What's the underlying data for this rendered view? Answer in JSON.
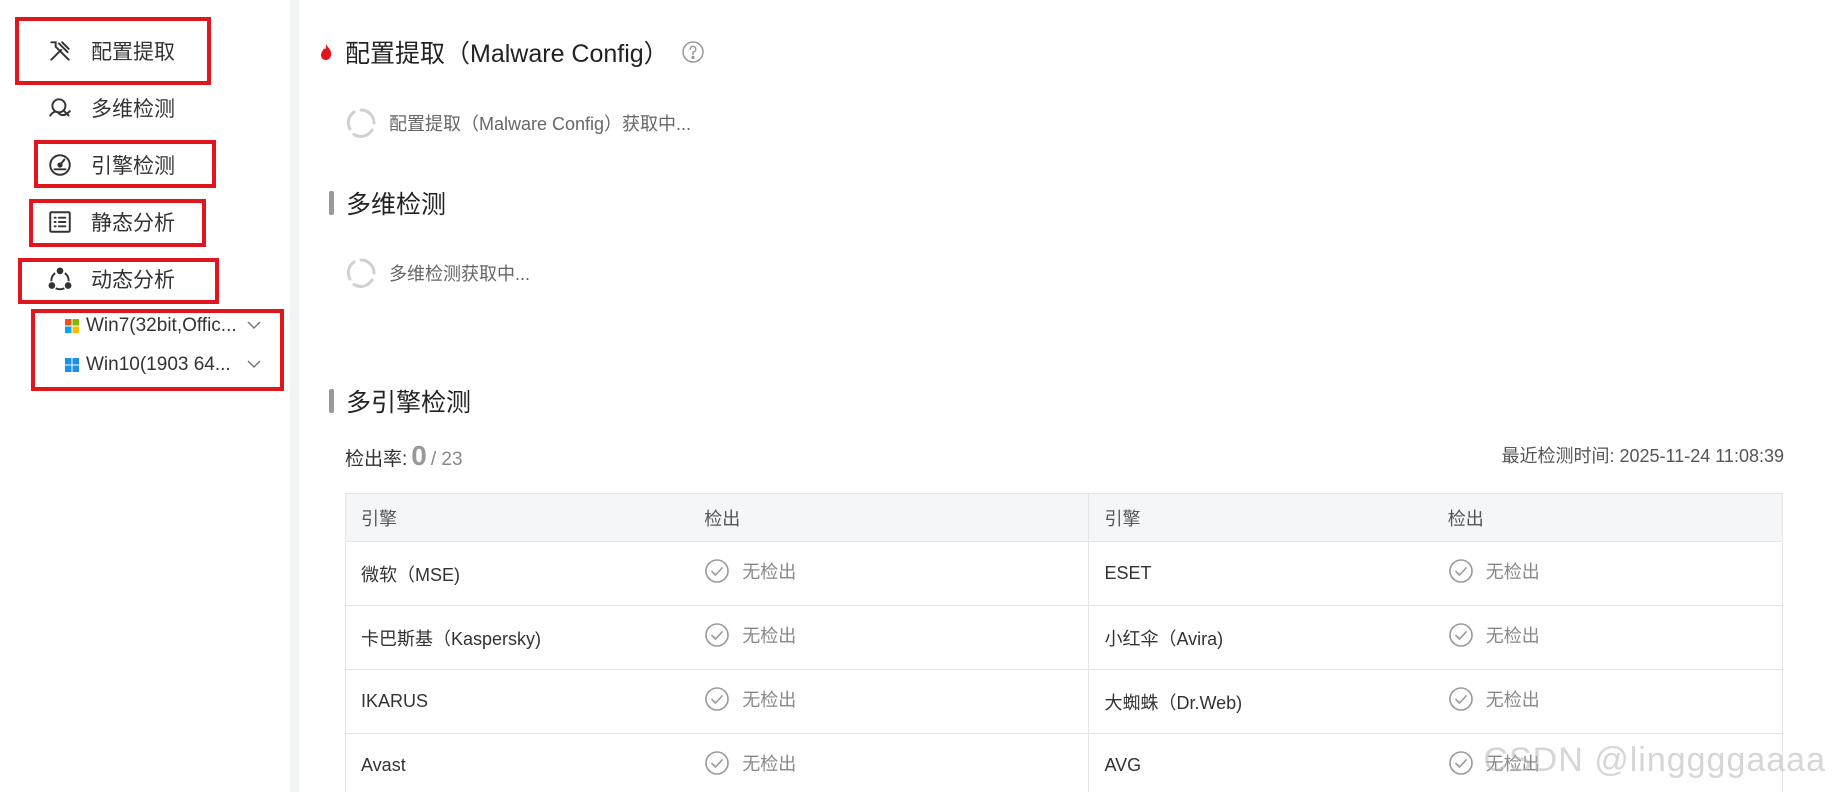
{
  "sidebar": {
    "items": [
      {
        "label": "配置提取",
        "icon": "tools-icon"
      },
      {
        "label": "多维检测",
        "icon": "multi-detect-icon"
      },
      {
        "label": "引擎检测",
        "icon": "engine-icon"
      },
      {
        "label": "静态分析",
        "icon": "list-icon"
      },
      {
        "label": "动态分析",
        "icon": "share-nodes-icon"
      }
    ],
    "sub_items": [
      {
        "label": "Win7(32bit,Offic...",
        "icon": "windows7-icon"
      },
      {
        "label": "Win10(1903 64...",
        "icon": "windows10-icon"
      }
    ]
  },
  "main": {
    "config": {
      "title": "配置提取（Malware Config）",
      "loading": "配置提取（Malware Config）获取中..."
    },
    "multi": {
      "title": "多维检测",
      "loading": "多维检测获取中..."
    },
    "engines": {
      "title": "多引擎检测",
      "rate_label": "检出率:",
      "detected": "0",
      "total": "/ 23",
      "last_time": "最近检测时间: 2025-11-24 11:08:39",
      "headers": [
        "引擎",
        "检出",
        "引擎",
        "检出"
      ],
      "rows": [
        {
          "left": "微软（MSE)",
          "left_status": "无检出",
          "right": "ESET",
          "right_status": "无检出"
        },
        {
          "left": "卡巴斯基（Kaspersky)",
          "left_status": "无检出",
          "right": "小红伞（Avira)",
          "right_status": "无检出"
        },
        {
          "left": "IKARUS",
          "left_status": "无检出",
          "right": "大蜘蛛（Dr.Web)",
          "right_status": "无检出"
        },
        {
          "left": "Avast",
          "left_status": "无检出",
          "right": "AVG",
          "right_status": "无检出"
        }
      ]
    }
  },
  "watermark": "CSDN @linggggaaaa",
  "colors": {
    "highlight_box": "#e0161c",
    "fire": "#e0161c",
    "windows10": "#1e90e8"
  }
}
